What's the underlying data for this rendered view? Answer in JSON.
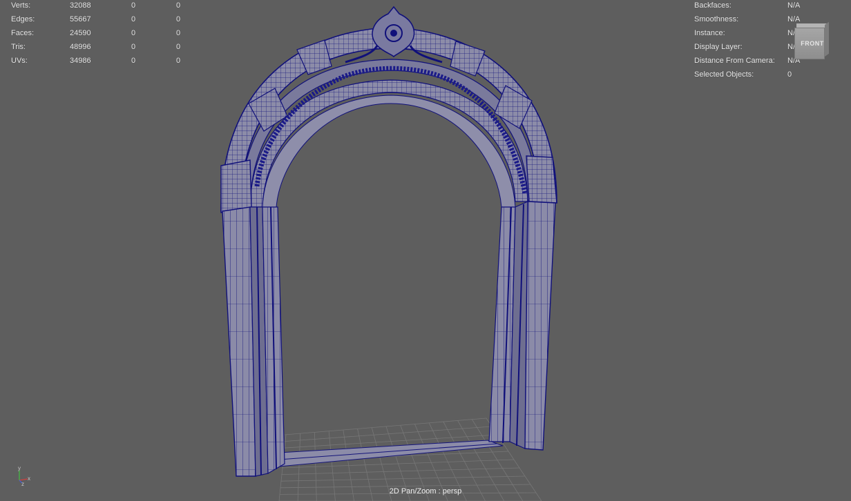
{
  "hud_left": {
    "rows": [
      {
        "label": "Verts:",
        "v1": "32088",
        "v2": "0",
        "v3": "0"
      },
      {
        "label": "Edges:",
        "v1": "55667",
        "v2": "0",
        "v3": "0"
      },
      {
        "label": "Faces:",
        "v1": "24590",
        "v2": "0",
        "v3": "0"
      },
      {
        "label": "Tris:",
        "v1": "48996",
        "v2": "0",
        "v3": "0"
      },
      {
        "label": "UVs:",
        "v1": "34986",
        "v2": "0",
        "v3": "0"
      }
    ]
  },
  "hud_right": {
    "rows": [
      {
        "label": "Backfaces:",
        "value": "N/A"
      },
      {
        "label": "Smoothness:",
        "value": "N/A"
      },
      {
        "label": "Instance:",
        "value": "N/A"
      },
      {
        "label": "Display Layer:",
        "value": "N/A"
      },
      {
        "label": "Distance From Camera:",
        "value": "N/A"
      },
      {
        "label": "Selected Objects:",
        "value": "0"
      }
    ]
  },
  "viewcube": {
    "face_label": "FRONT"
  },
  "camera": {
    "label": "2D Pan/Zoom : persp"
  },
  "axis_gizmo": {
    "x_label": "x",
    "y_label": "y",
    "z_label": "z"
  },
  "colors": {
    "viewport_bg": "#5e5e5e",
    "wireframe": "#10107a",
    "mesh_fill": "#8a8aa6",
    "grid": "#7a7a7a",
    "axis_x": "#d04040",
    "axis_y": "#40c040",
    "axis_z": "#4060e0"
  },
  "icons": {
    "viewcube": "viewcube-icon",
    "axis": "axis-gizmo-icon"
  }
}
